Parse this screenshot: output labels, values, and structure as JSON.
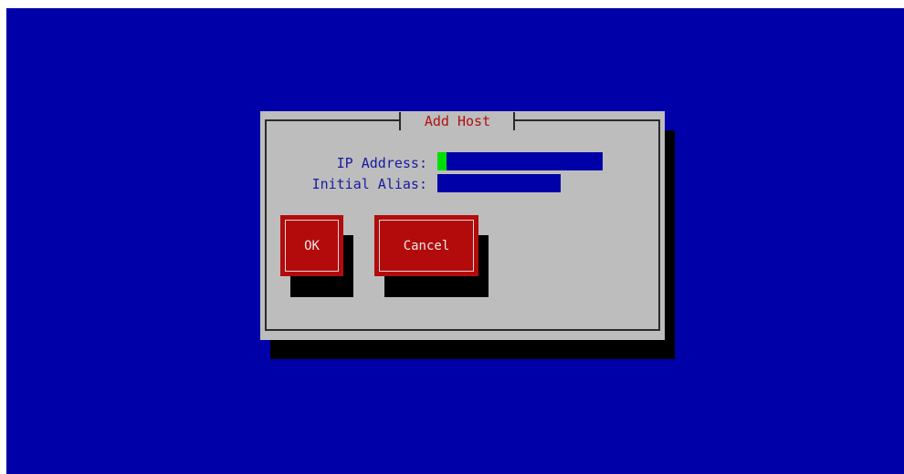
{
  "dialog": {
    "title": "Add Host"
  },
  "fields": {
    "ip_address": {
      "label": "IP Address:",
      "value": ""
    },
    "initial_alias": {
      "label": "Initial Alias:",
      "value": ""
    }
  },
  "buttons": {
    "ok_label": "OK",
    "cancel_label": "Cancel"
  },
  "colors": {
    "background": "#0000a8",
    "dialog": "#bdbdbd",
    "title_text": "#b01010",
    "label_text": "#1a1aa0",
    "button": "#b30b0b",
    "cursor": "#00e000"
  }
}
